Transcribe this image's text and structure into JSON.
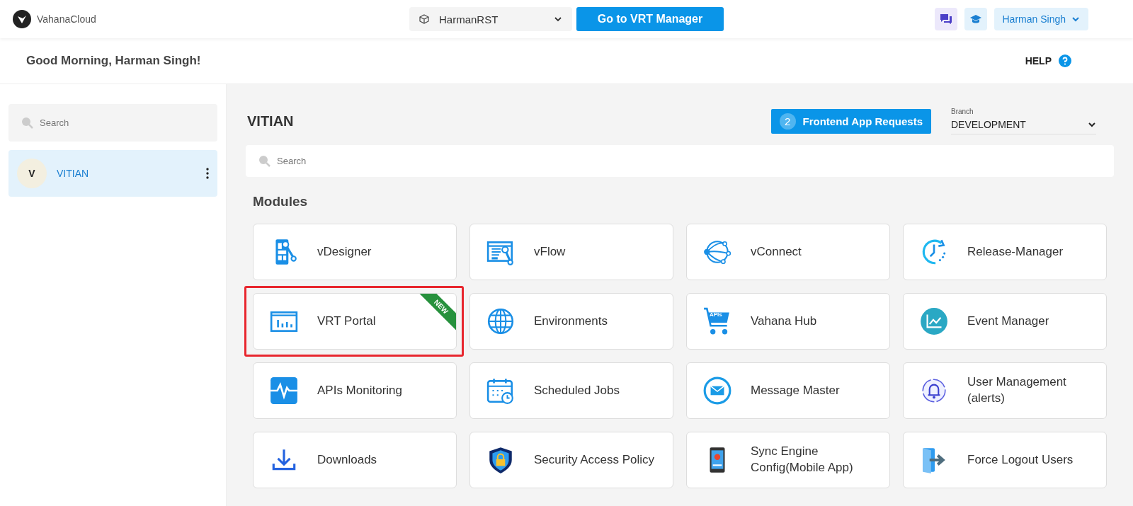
{
  "header": {
    "logo_text": "VahanaCloud",
    "workspace": "HarmanRST",
    "vrt_button": "Go to VRT Manager",
    "user": "Harman Singh"
  },
  "greeting": {
    "text": "Good Morning, Harman Singh!",
    "help": "HELP"
  },
  "sidebar": {
    "search": {
      "placeholder": "Search"
    },
    "items": [
      {
        "avatar": "V",
        "name": "VITIAN",
        "selected": true
      }
    ]
  },
  "main": {
    "title": "VITIAN",
    "requests_button": {
      "count": "2",
      "label": "Frontend App Requests"
    },
    "branch": {
      "label": "Branch",
      "value": "DEVELOPMENT"
    },
    "search": {
      "placeholder": "Search"
    },
    "section": "Modules",
    "modules": [
      {
        "kind": "designer",
        "label": "vDesigner",
        "highlighted": false
      },
      {
        "kind": "flow",
        "label": "vFlow",
        "highlighted": false
      },
      {
        "kind": "connect",
        "label": "vConnect",
        "highlighted": false
      },
      {
        "kind": "release",
        "label": "Release-Manager",
        "highlighted": false
      },
      {
        "kind": "portal",
        "label": "VRT Portal",
        "badge": "NEW",
        "highlighted": true
      },
      {
        "kind": "globe",
        "label": "Environments",
        "highlighted": false
      },
      {
        "kind": "cart",
        "label": "Vahana Hub",
        "icon_text": "APIs",
        "highlighted": false
      },
      {
        "kind": "chart",
        "label": "Event Manager",
        "highlighted": false
      },
      {
        "kind": "pulse",
        "label": "APIs Monitoring",
        "highlighted": false
      },
      {
        "kind": "calendar",
        "label": "Scheduled Jobs",
        "highlighted": false
      },
      {
        "kind": "mail",
        "label": "Message Master",
        "highlighted": false
      },
      {
        "kind": "bell",
        "label": "User Management (alerts)",
        "highlighted": false
      },
      {
        "kind": "download",
        "label": "Downloads",
        "highlighted": false
      },
      {
        "kind": "shield",
        "label": "Security Access Policy",
        "highlighted": false
      },
      {
        "kind": "phone",
        "label": "Sync Engine Config(Mobile App)",
        "highlighted": false
      },
      {
        "kind": "logout",
        "label": "Force Logout Users",
        "highlighted": false
      }
    ]
  }
}
